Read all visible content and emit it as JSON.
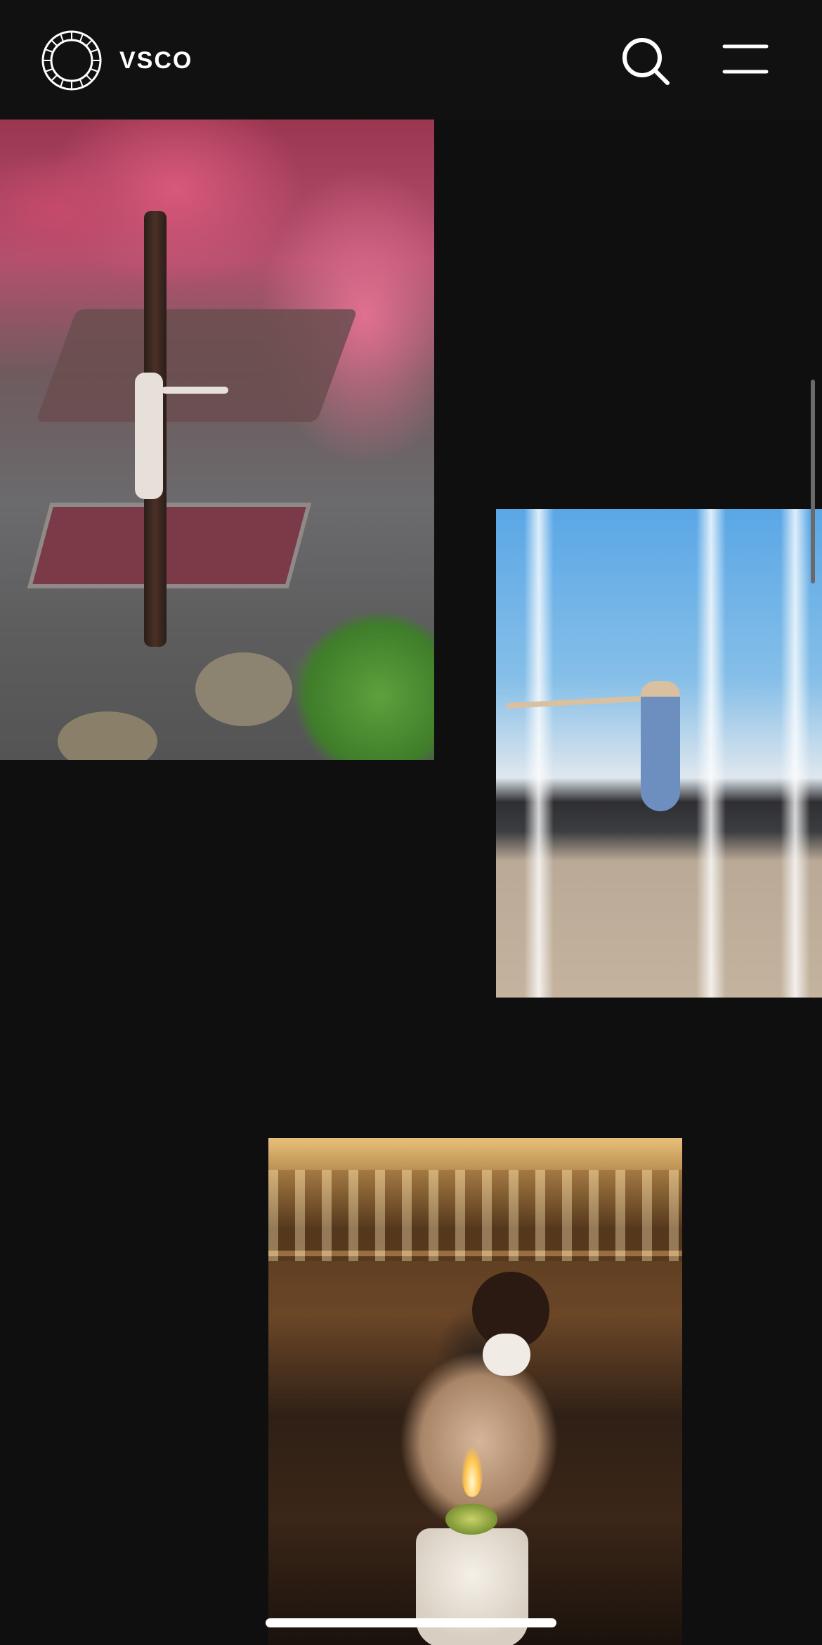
{
  "header": {
    "brand": "VSCO",
    "logo_icon": "vsco-aperture-logo-icon",
    "search_icon": "search-icon",
    "menu_icon": "hamburger-menu-icon"
  },
  "gallery": {
    "photos": [
      {
        "id": "photo-1",
        "subject": "pink-tree-park"
      },
      {
        "id": "photo-2",
        "subject": "dancer-blue-sky"
      },
      {
        "id": "photo-3",
        "subject": "bartender-flaming-drink"
      }
    ]
  },
  "colors": {
    "background": "#0f0f0f",
    "header": "#111111",
    "foreground": "#ffffff"
  }
}
